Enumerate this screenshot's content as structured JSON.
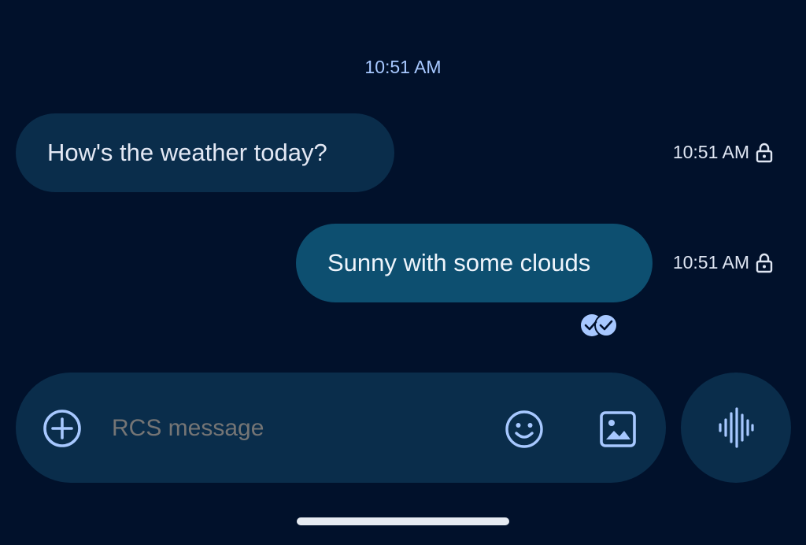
{
  "conversation": {
    "date_stamp": "10:51 AM",
    "messages": [
      {
        "direction": "incoming",
        "text": "How's the weather today?",
        "time": "10:51 AM"
      },
      {
        "direction": "outgoing",
        "text": "Sunny with some clouds",
        "time": "10:51 AM"
      }
    ]
  },
  "composer": {
    "placeholder": "RCS message",
    "value": ""
  },
  "icons": {
    "add": "add-circle-icon",
    "emoji": "emoji-icon",
    "gallery": "gallery-icon",
    "voice": "voice-waveform-icon",
    "lock": "lock-icon",
    "read_status": "read-receipt-icon"
  },
  "colors": {
    "background": "#01112b",
    "incoming_bubble": "#0a2d4b",
    "outgoing_bubble": "#0d4f70",
    "accent": "#a7c8ff"
  }
}
